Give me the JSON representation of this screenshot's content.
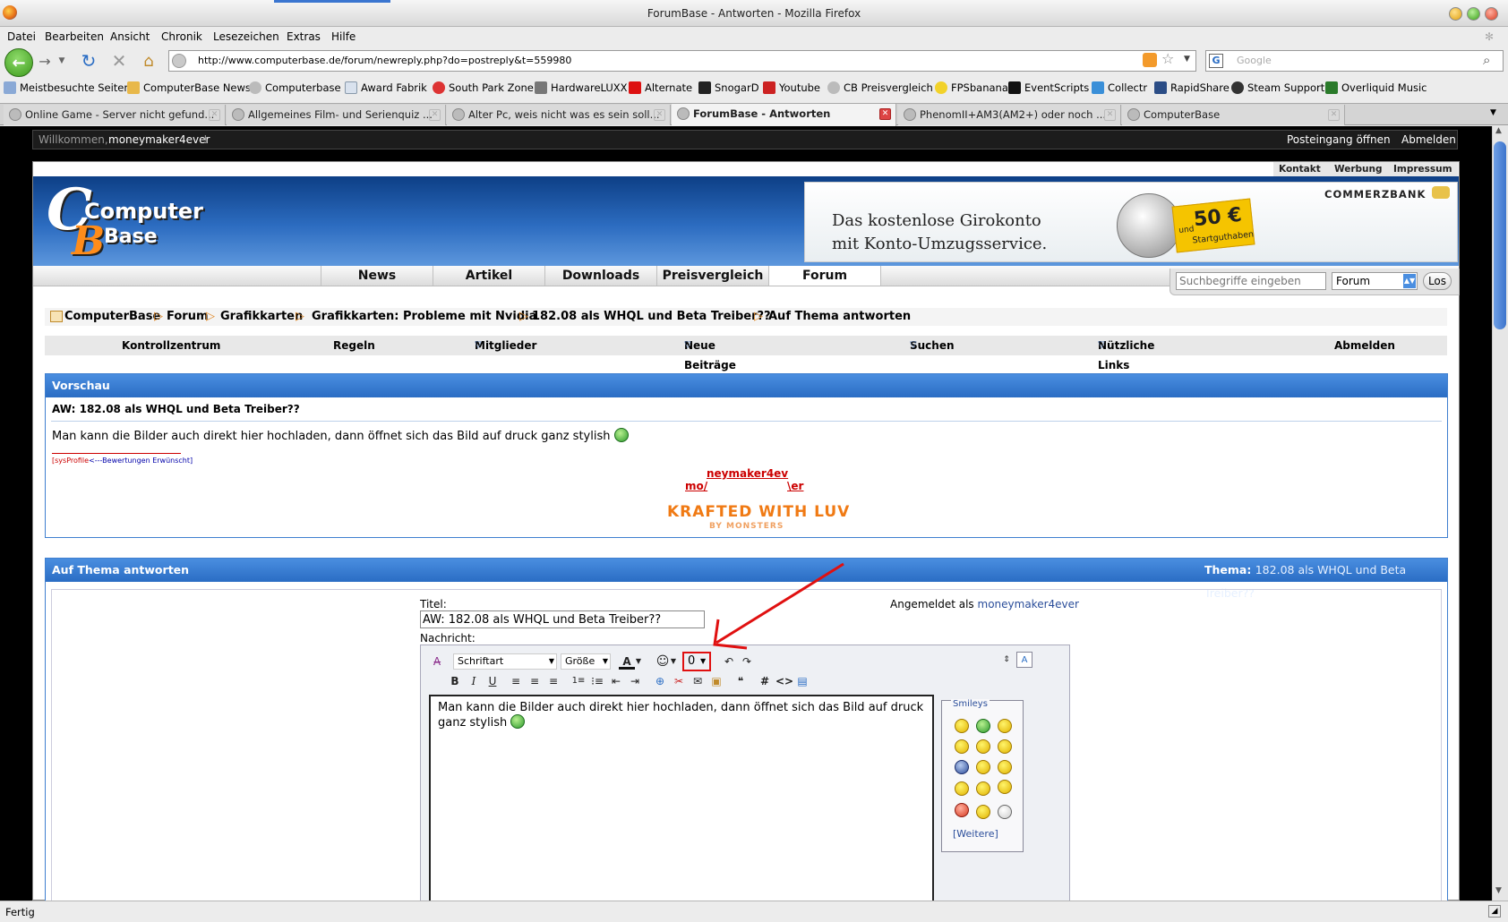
{
  "window": {
    "title": "ForumBase - Antworten - Mozilla Firefox"
  },
  "menu": [
    "Datei",
    "Bearbeiten",
    "Ansicht",
    "Chronik",
    "Lesezeichen",
    "Extras",
    "Hilfe"
  ],
  "urlbar": {
    "value": "http://www.computerbase.de/forum/newreply.php?do=postreply&t=559980"
  },
  "searchbar": {
    "placeholder": "Google"
  },
  "bookmarks": [
    "Meistbesuchte Seiten",
    "ComputerBase News",
    "Computerbase",
    "Award Fabrik",
    "South Park Zone",
    "HardwareLUXX",
    "Alternate",
    "SnogarD",
    "Youtube",
    "CB Preisvergleich",
    "FPSbanana",
    "EventScripts",
    "Collectr",
    "RapidShare",
    "Steam Support",
    "Overliquid Music"
  ],
  "tabs": [
    {
      "label": "Online Game - Server nicht gefund..."
    },
    {
      "label": "Allgemeines Film- und Serienquiz ..."
    },
    {
      "label": "Alter Pc, weis nicht was es sein soll..."
    },
    {
      "label": "ForumBase - Antworten"
    },
    {
      "label": "PhenomII+AM3(AM2+) oder noch ..."
    },
    {
      "label": "ComputerBase"
    }
  ],
  "status": "Fertig",
  "site": {
    "welcome_prefix": "Willkommen,",
    "username": "moneymaker4ever",
    "welcome_suffix": "!",
    "inbox": "Posteingang öffnen",
    "logout": "Abmelden",
    "toplinks": [
      "Kontakt",
      "Werbung",
      "Impressum"
    ],
    "logo_line1": "Computer",
    "logo_line2": "Base",
    "ad": {
      "brand": "COMMERZBANK",
      "line1": "Das kostenlose Girokonto",
      "line2": "mit Konto-Umzugsservice.",
      "badge_amount": "50 €",
      "badge_prefix": "und",
      "badge_label": "Startguthaben"
    },
    "mainnav": [
      "News",
      "Artikel",
      "Downloads",
      "Preisvergleich",
      "Forum"
    ],
    "search": {
      "placeholder": "Suchbegriffe eingeben",
      "scope": "Forum",
      "button": "Los"
    },
    "breadcrumb": [
      "ComputerBase",
      "Forum",
      "Grafikkarten",
      "Grafikkarten: Probleme mit Nvidia",
      "182.08 als WHQL und Beta Treiber??",
      "Auf Thema antworten"
    ],
    "subnav": [
      "Kontrollzentrum",
      "Regeln",
      "Mitglieder",
      "Neue Beiträge",
      "Suchen",
      "Nützliche Links",
      "Abmelden"
    ]
  },
  "preview": {
    "heading": "Vorschau",
    "post_title": "AW: 182.08 als WHQL und Beta Treiber??",
    "body": "Man kann die Bilder auch direkt hier hochladen, dann öffnet sich das Bild auf druck ganz stylish",
    "sig_link_a": "[sysProfile",
    "sig_link_b": "<---Bewertungen Erwünscht]",
    "sig_art_top": "neymaker4ev",
    "sig_art_left": "mo/",
    "sig_art_right": "\\er",
    "sig_banner": "KRAFTED WITH LUV",
    "sig_banner_sub": "BY MONSTERS"
  },
  "reply": {
    "heading": "Auf Thema antworten",
    "thread_label": "Thema:",
    "thread_title": "182.08 als WHQL und Beta Treiber??",
    "title_label": "Titel:",
    "title_value": "AW: 182.08 als WHQL und Beta Treiber??",
    "logged_in_label": "Angemeldet als",
    "logged_in_user": "moneymaker4ever",
    "message_label": "Nachricht:",
    "font_select": "Schriftart",
    "size_select": "Größe",
    "message_text": "Man kann die Bilder auch direkt hier hochladen, dann öffnet sich das Bild auf druck ganz stylish",
    "smileys_label": "Smileys",
    "more_smileys": "Weitere"
  },
  "colors": {
    "accent": "#2a6dc4",
    "annotation_arrow": "#e01010",
    "signature_red": "#cc0000",
    "signature_orange": "#f07a14"
  }
}
